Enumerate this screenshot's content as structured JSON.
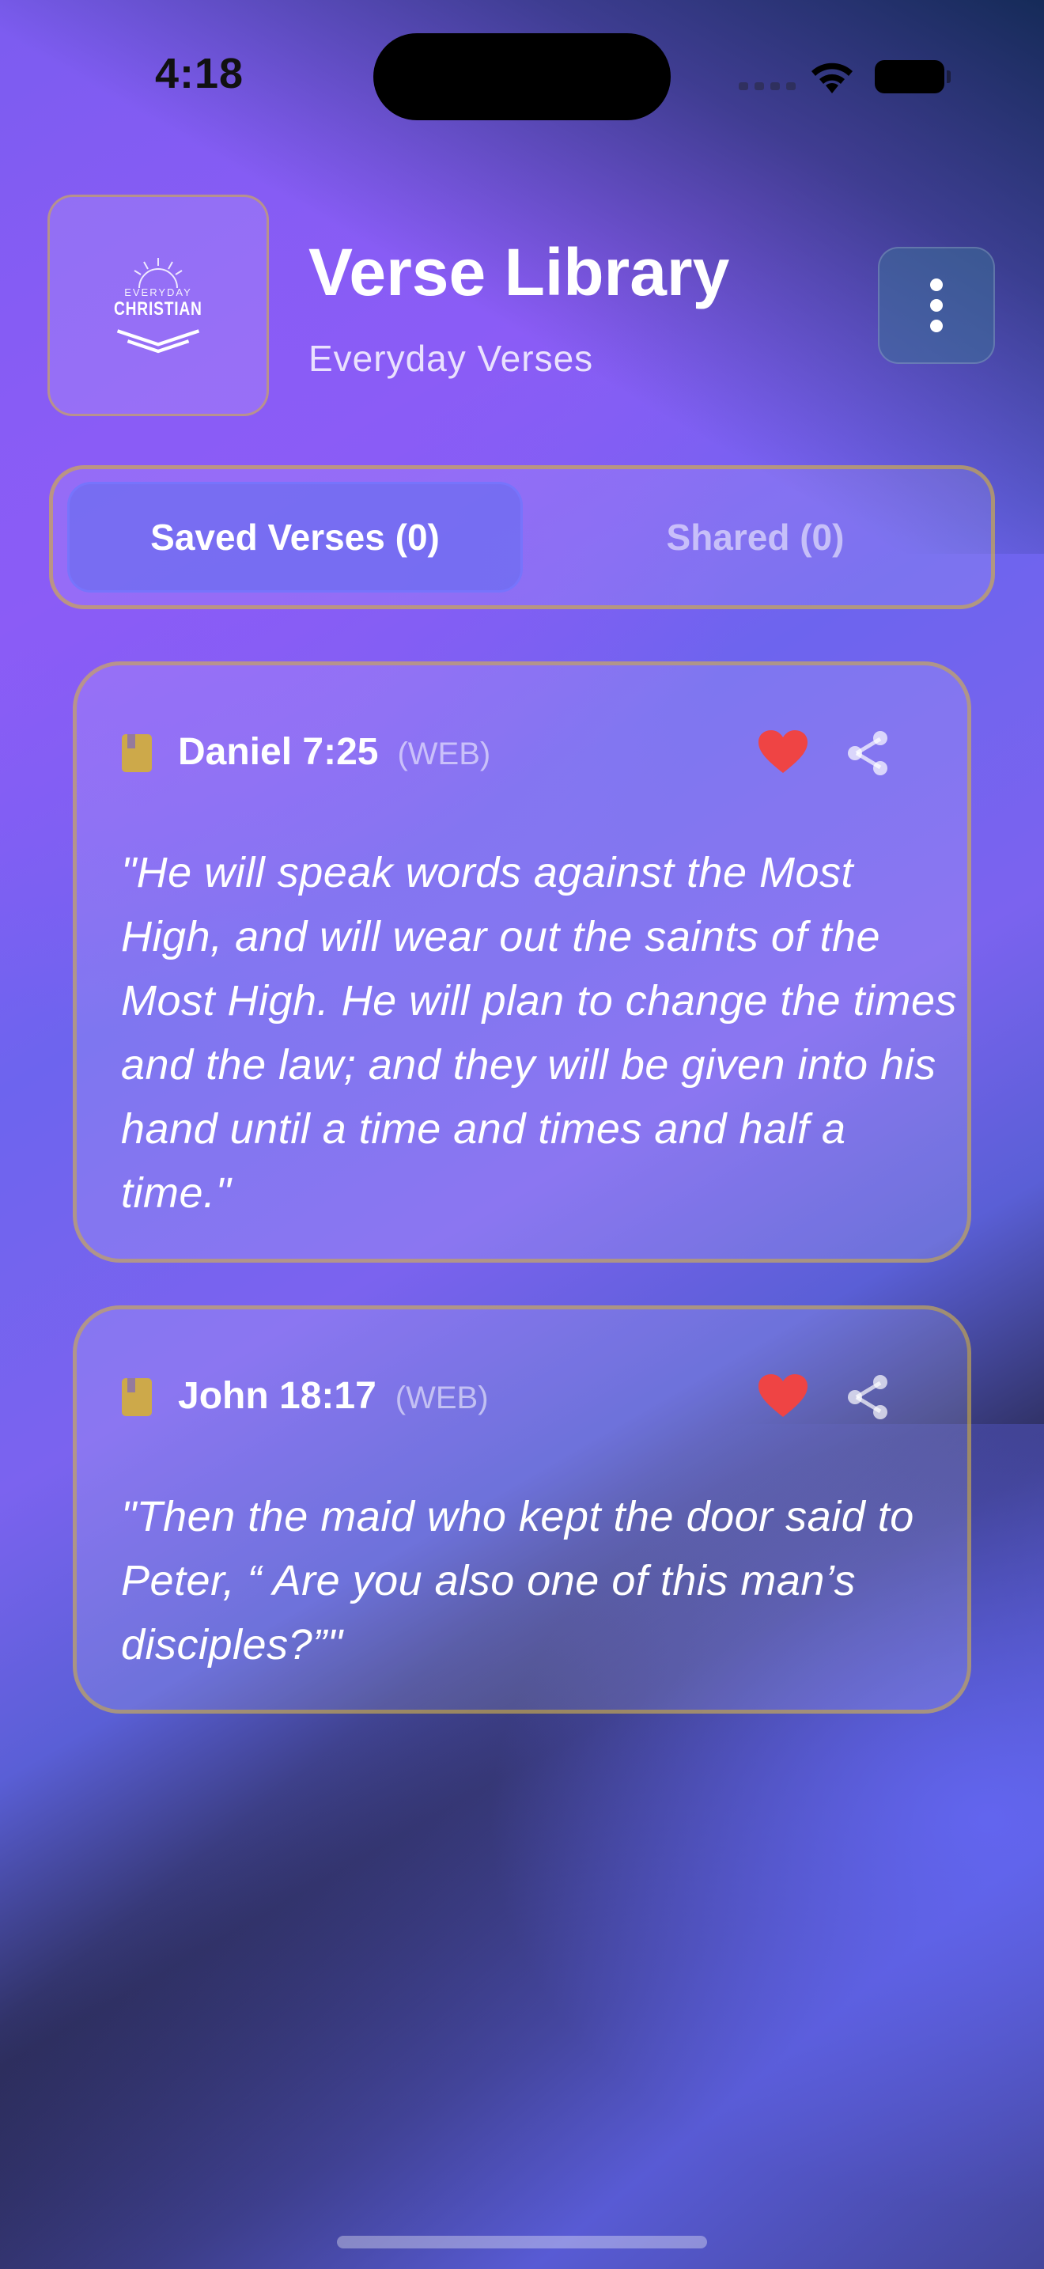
{
  "status_bar": {
    "time": "4:18"
  },
  "header": {
    "title": "Verse Library",
    "subtitle": "Everyday Verses",
    "logo": {
      "line1": "EVERYDAY",
      "line2": "CHRISTIAN"
    }
  },
  "tabs": [
    {
      "label": "Saved Verses (0)",
      "active": true
    },
    {
      "label": "Shared (0)",
      "active": false
    }
  ],
  "verses": [
    {
      "reference": "Daniel 7:25",
      "translation": "(WEB)",
      "text": "\"He will speak words against the Most High, and will wear out the saints of the Most High. He will plan to change the times and the law; and they will be given into his hand until a time and times and half a time.\""
    },
    {
      "reference": "John 18:17",
      "translation": "(WEB)",
      "text": "\"Then the maid who kept the door said to Peter, “ Are you also one of this man’s disciples?”\""
    }
  ],
  "colors": {
    "accent_gold": "#d4af37",
    "heart_red": "#ef4444",
    "primary_indigo": "#6366f1",
    "violet": "#8b5cf6"
  }
}
